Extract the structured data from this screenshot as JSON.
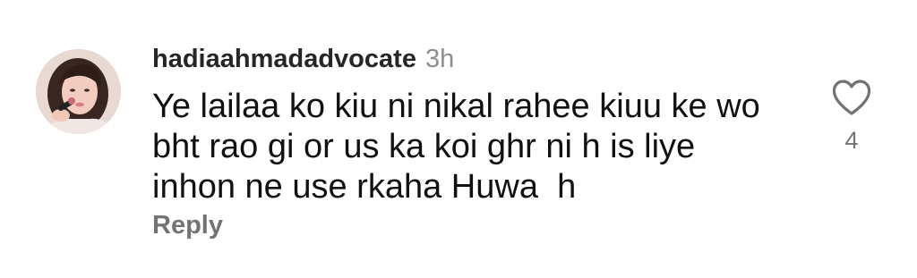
{
  "comment": {
    "username": "hadiaahmadadvocate",
    "time_ago": "3h",
    "text": "Ye lailaa ko kiu ni nikal rahee kiuu ke wo\nbht rao gi or us ka koi ghr ni h is liye\ninhon ne use rkaha Huwa  h",
    "reply_label": "Reply",
    "like_count": "4",
    "avatar_icon": "profile-photo",
    "like_icon": "heart-outline-icon"
  }
}
